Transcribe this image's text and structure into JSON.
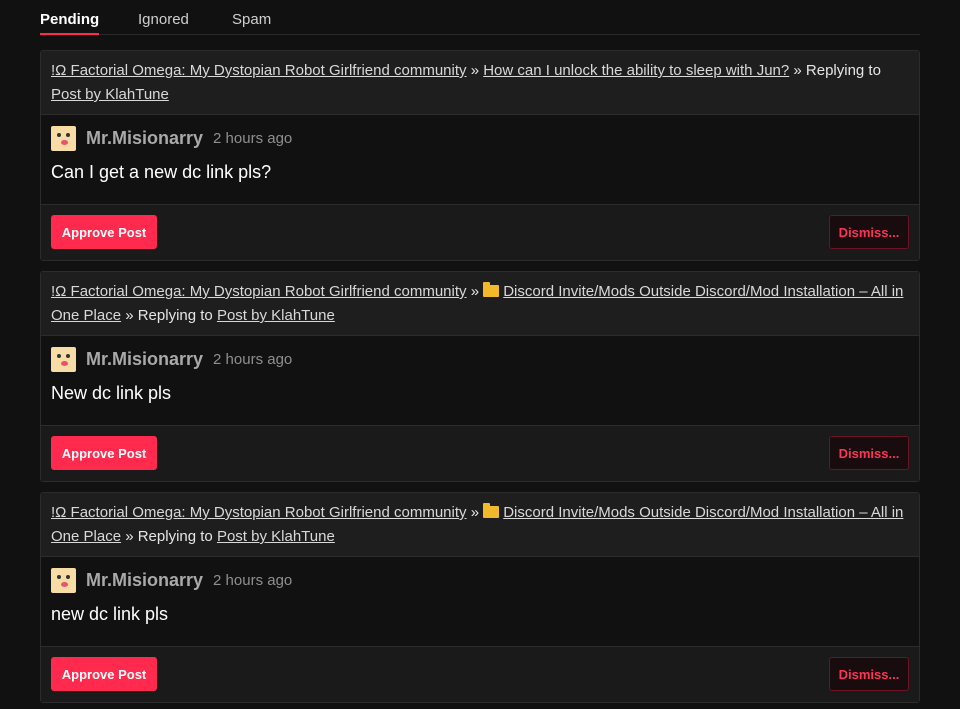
{
  "tabs": [
    {
      "label": "Pending",
      "active": true
    },
    {
      "label": "Ignored",
      "active": false
    },
    {
      "label": "Spam",
      "active": false
    }
  ],
  "colors": {
    "accent": "#ff2a4d",
    "background": "#111111",
    "card_header": "#1e1e1e"
  },
  "posts": [
    {
      "community_link": "!Ω Factorial Omega: My Dystopian Robot Girlfriend community",
      "separator": "»",
      "topic_link": "How can I unlock the ability to sleep with Jun?",
      "replying_to_text": "» Replying to",
      "reply_link": "Post by KlahTune",
      "author": "Mr.Misionarry",
      "time": "2 hours ago",
      "text": "Can I get a new dc link pls?",
      "approve_label": "Approve Post",
      "dismiss_label": "Dismiss..."
    },
    {
      "community_link": "!Ω Factorial Omega: My Dystopian Robot Girlfriend community",
      "separator": "»",
      "topic_icon": "folder-icon",
      "topic_link": "Discord Invite/Mods Outside Discord/Mod Installation – All in One Place",
      "replying_to_text": "» Replying to",
      "reply_link": "Post by KlahTune",
      "author": "Mr.Misionarry",
      "time": "2 hours ago",
      "text": "New dc link pls",
      "approve_label": "Approve Post",
      "dismiss_label": "Dismiss..."
    },
    {
      "community_link": "!Ω Factorial Omega: My Dystopian Robot Girlfriend community",
      "separator": "»",
      "topic_icon": "folder-icon",
      "topic_link": "Discord Invite/Mods Outside Discord/Mod Installation – All in One Place",
      "replying_to_text": "» Replying to",
      "reply_link": "Post by KlahTune",
      "author": "Mr.Misionarry",
      "time": "2 hours ago",
      "text": "new dc link pls",
      "approve_label": "Approve Post",
      "dismiss_label": "Dismiss..."
    }
  ]
}
